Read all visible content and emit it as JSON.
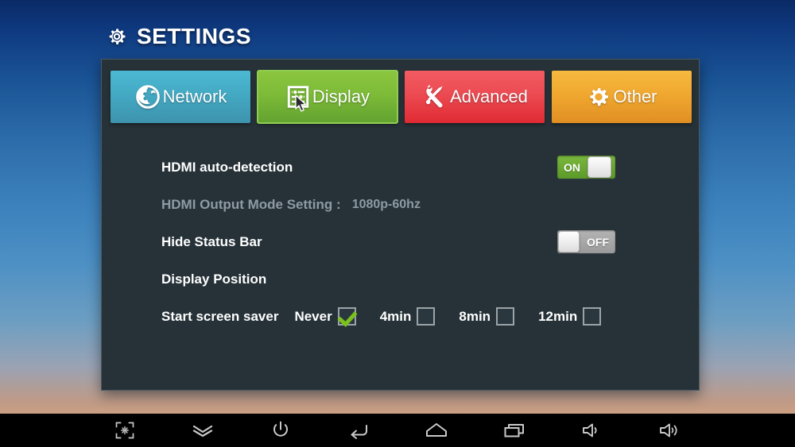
{
  "header": {
    "title": "SETTINGS",
    "gear_icon": "gear-icon"
  },
  "tabs": [
    {
      "id": "network",
      "label": "Network",
      "icon": "globe-icon",
      "color": "#43a8c2",
      "active": false
    },
    {
      "id": "display",
      "label": "Display",
      "icon": "sliders-icon",
      "color": "#7dbb38",
      "active": true
    },
    {
      "id": "advanced",
      "label": "Advanced",
      "icon": "tools-icon",
      "color": "#ec4b52",
      "active": false
    },
    {
      "id": "other",
      "label": "Other",
      "icon": "gear-icon",
      "color": "#f0a830",
      "active": false
    }
  ],
  "settings": {
    "hdmi_auto_detection": {
      "label": "HDMI auto-detection",
      "toggle_state": "ON",
      "toggle_on": true
    },
    "hdmi_output_mode": {
      "label": "HDMI Output Mode Setting :",
      "value": "1080p-60hz",
      "disabled": true
    },
    "hide_status_bar": {
      "label": "Hide Status Bar",
      "toggle_state": "OFF",
      "toggle_on": false
    },
    "display_position": {
      "label": "Display Position"
    },
    "screen_saver": {
      "label": "Start screen saver",
      "options": [
        {
          "label": "Never",
          "checked": true
        },
        {
          "label": "4min",
          "checked": false
        },
        {
          "label": "8min",
          "checked": false
        },
        {
          "label": "12min",
          "checked": false
        }
      ]
    }
  },
  "navbar": {
    "buttons": [
      {
        "id": "screenshot",
        "icon": "screenshot-icon"
      },
      {
        "id": "collapse",
        "icon": "double-chevron-down-icon"
      },
      {
        "id": "power",
        "icon": "power-icon"
      },
      {
        "id": "back",
        "icon": "back-arrow-icon"
      },
      {
        "id": "home",
        "icon": "home-icon"
      },
      {
        "id": "recents",
        "icon": "recent-apps-icon"
      },
      {
        "id": "volume-down",
        "icon": "volume-down-icon"
      },
      {
        "id": "volume-up",
        "icon": "volume-up-icon"
      }
    ]
  },
  "colors": {
    "panel_bg": "#263238",
    "accent_green": "#7dbb38",
    "toggle_on": "#6aa832",
    "toggle_off": "#a6a6a6",
    "dim_text": "#8e9ba3"
  }
}
